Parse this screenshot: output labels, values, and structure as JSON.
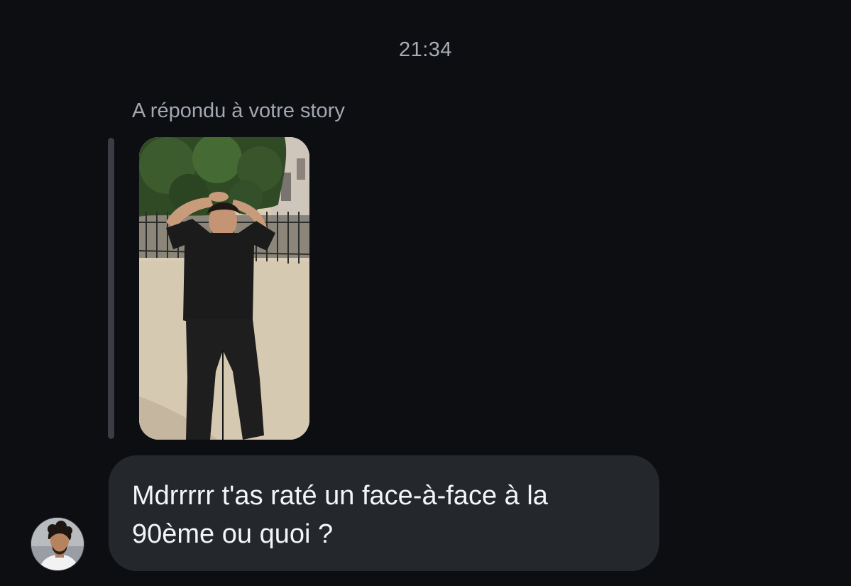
{
  "chat": {
    "timestamp": "21:34",
    "reply_context": "A répondu à votre story",
    "story_image": "story-photo-person-in-black-outfit-in-park",
    "message_text": "Mdrrrrr t'as raté un face-à-face à la\n90ème ou quoi ?",
    "sender_avatar": "user-avatar"
  },
  "colors": {
    "background": "#0c0e12",
    "bubble": "#24272c",
    "muted_text": "#a2a7b0",
    "message_text": "#f4f5f7",
    "reply_bar": "#3a3d44"
  }
}
